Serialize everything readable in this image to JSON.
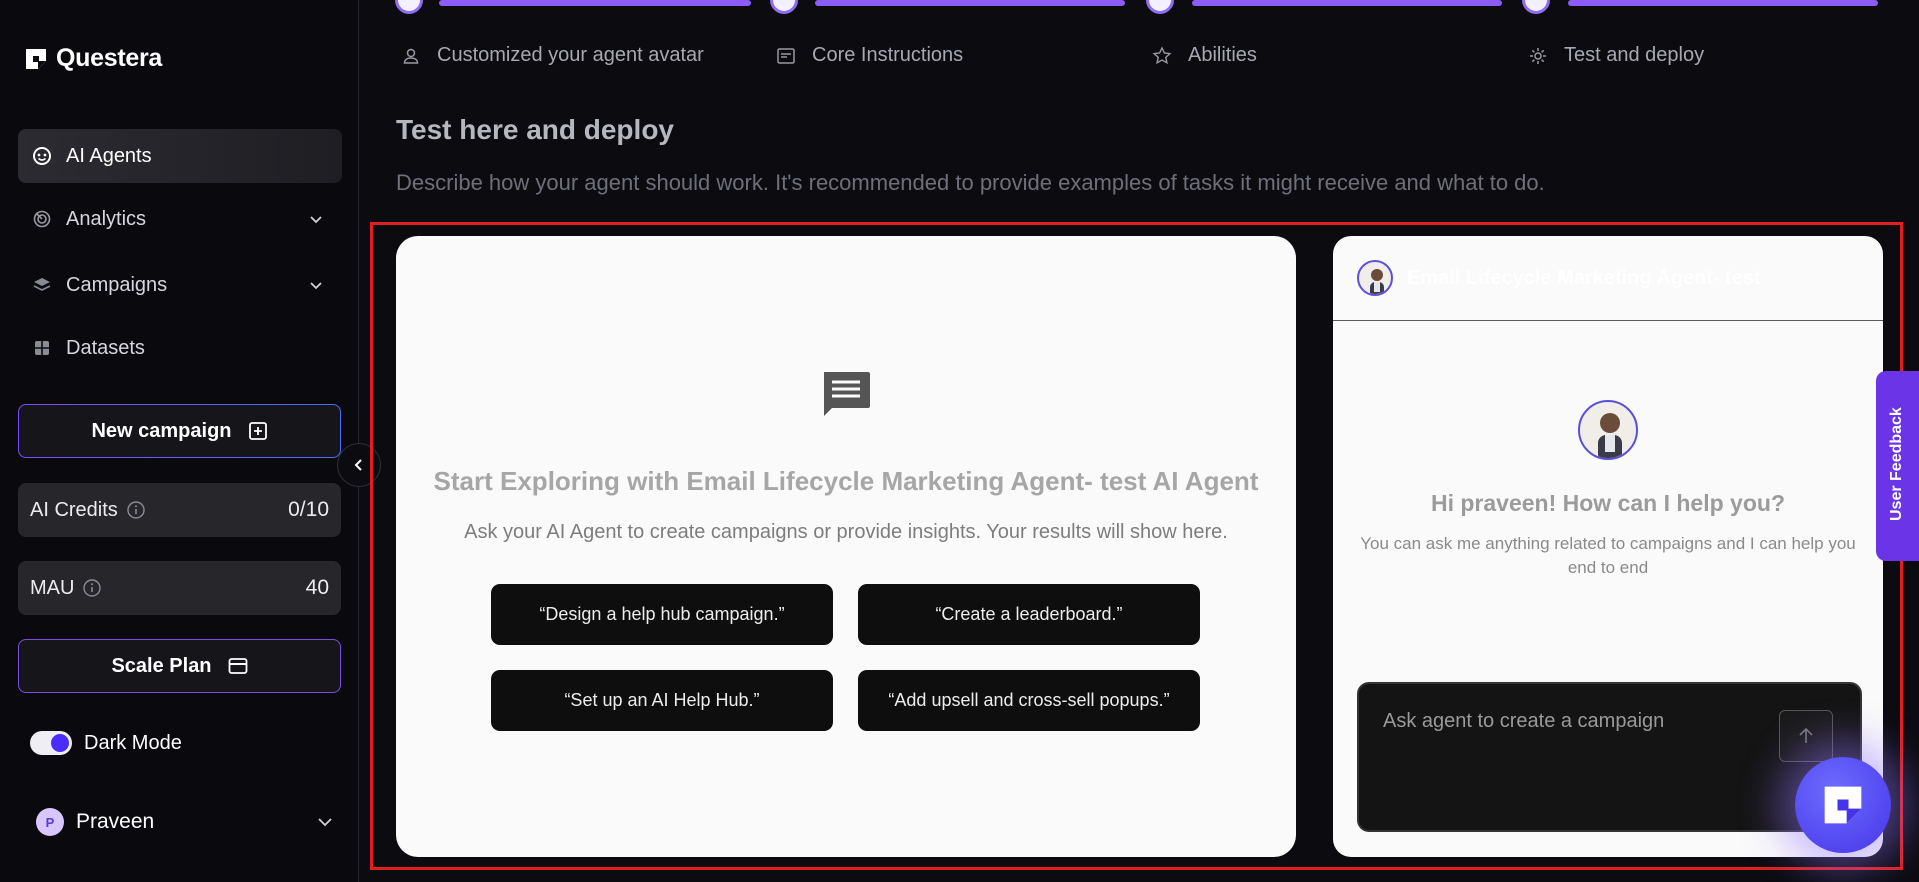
{
  "app": {
    "name": "Questera"
  },
  "sidebar": {
    "items": [
      {
        "label": "AI Agents",
        "icon": "agent-face-icon",
        "active": true
      },
      {
        "label": "Analytics",
        "icon": "analytics-icon"
      },
      {
        "label": "Campaigns",
        "icon": "layers-icon"
      },
      {
        "label": "Datasets",
        "icon": "grid-icon"
      }
    ],
    "new_campaign": "New campaign",
    "credits": {
      "label": "AI Credits",
      "value": "0/10"
    },
    "mau": {
      "label": "MAU",
      "value": "40"
    },
    "scale_plan": "Scale Plan",
    "dark_mode": {
      "label": "Dark Mode",
      "on": true
    },
    "user": {
      "initial": "P",
      "name": "Praveen"
    }
  },
  "steps": [
    {
      "label": "Customized your agent avatar",
      "icon": "user-icon"
    },
    {
      "label": "Core Instructions",
      "icon": "document-icon"
    },
    {
      "label": "Abilities",
      "icon": "star-icon"
    },
    {
      "label": "Test and deploy",
      "icon": "gear-icon"
    }
  ],
  "section": {
    "title": "Test here and deploy",
    "description": "Describe how your agent should work. It's recommended to provide examples of tasks it might receive and what to do."
  },
  "explore": {
    "title": "Start Exploring with Email Lifecycle Marketing Agent- test AI Agent",
    "subtitle": "Ask your AI Agent to create campaigns or provide insights. Your results will show here.",
    "prompts": [
      "“Design a help hub campaign.”",
      "“Create a leaderboard.”",
      "“Set up an AI Help Hub.”",
      "“Add upsell and cross-sell popups.”"
    ]
  },
  "chat": {
    "agent_name": "Email Lifecycle Marketing Agent- test",
    "greeting": "Hi praveen! How can I help you?",
    "greeting_sub": "You can ask me anything related to campaigns and I can help you end to end",
    "input_placeholder": "Ask agent to create a campaign"
  },
  "feedback": {
    "label": "User Feedback"
  },
  "colors": {
    "accent": "#8b5cf6",
    "fab": "#4635e8",
    "highlight": "#e02020"
  }
}
